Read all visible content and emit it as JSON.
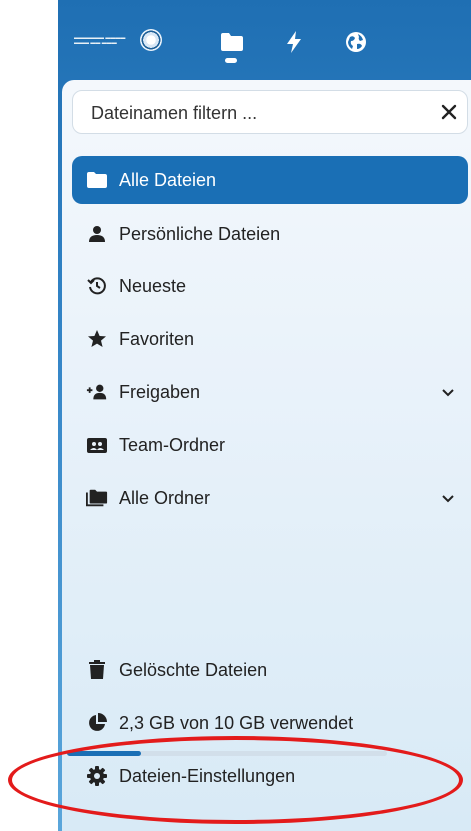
{
  "topbar": {
    "icons": [
      "university-seal-logo",
      "folder-icon",
      "activity-bolt-icon",
      "globe-icon"
    ]
  },
  "filter": {
    "placeholder": "Dateinamen filtern ..."
  },
  "nav": {
    "items": [
      {
        "label": "Alle Dateien",
        "icon": "folder-icon",
        "active": true
      },
      {
        "label": "Persönliche Dateien",
        "icon": "user-icon"
      },
      {
        "label": "Neueste",
        "icon": "history-icon"
      },
      {
        "label": "Favoriten",
        "icon": "star-icon"
      },
      {
        "label": "Freigaben",
        "icon": "share-user-icon",
        "expandable": true
      },
      {
        "label": "Team-Ordner",
        "icon": "team-folder-icon"
      },
      {
        "label": "Alle Ordner",
        "icon": "folders-icon",
        "expandable": true
      }
    ]
  },
  "footer": {
    "trash_label": "Gelöschte Dateien",
    "quota_label": "2,3 GB von 10 GB verwendet",
    "quota_fraction": 0.23,
    "settings_label": "Dateien-Einstellungen"
  },
  "colors": {
    "accent": "#1a6fb5",
    "highlight": "#e31b1b"
  }
}
